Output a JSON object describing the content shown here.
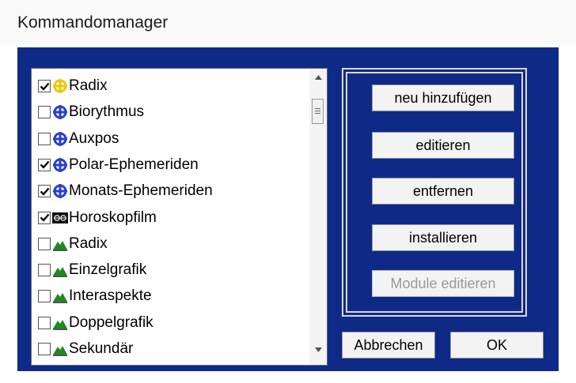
{
  "window": {
    "title": "Kommandomanager"
  },
  "list": {
    "items": [
      {
        "label": "Radix",
        "checked": true,
        "icon": "yellow-astro-wheel-icon"
      },
      {
        "label": "Biorythmus",
        "checked": false,
        "icon": "blue-astro-wheel-icon"
      },
      {
        "label": "Auxpos",
        "checked": false,
        "icon": "blue-astro-wheel-icon"
      },
      {
        "label": "Polar-Ephemeriden",
        "checked": true,
        "icon": "blue-astro-wheel-icon"
      },
      {
        "label": "Monats-Ephemeriden",
        "checked": true,
        "icon": "blue-astro-wheel-icon"
      },
      {
        "label": "Horoskopfilm",
        "checked": true,
        "icon": "film-icon"
      },
      {
        "label": "Radix",
        "checked": false,
        "icon": "green-mountain-icon"
      },
      {
        "label": "Einzelgrafik",
        "checked": false,
        "icon": "green-mountain-icon"
      },
      {
        "label": "Interaspekte",
        "checked": false,
        "icon": "green-mountain-icon"
      },
      {
        "label": "Doppelgrafik",
        "checked": false,
        "icon": "green-mountain-icon"
      },
      {
        "label": "Sekundär",
        "checked": false,
        "icon": "green-mountain-icon"
      }
    ]
  },
  "buttons": {
    "add": "neu hinzufügen",
    "edit": "editieren",
    "remove": "entfernen",
    "install": "installieren",
    "edit_modules": "Module editieren",
    "cancel": "Abbrechen",
    "ok": "OK"
  },
  "colors": {
    "client_bg": "#0f2a86",
    "wheel_yellow": "#f2c500",
    "wheel_blue": "#2a3fd0",
    "mountain_green": "#1f8a1f"
  }
}
